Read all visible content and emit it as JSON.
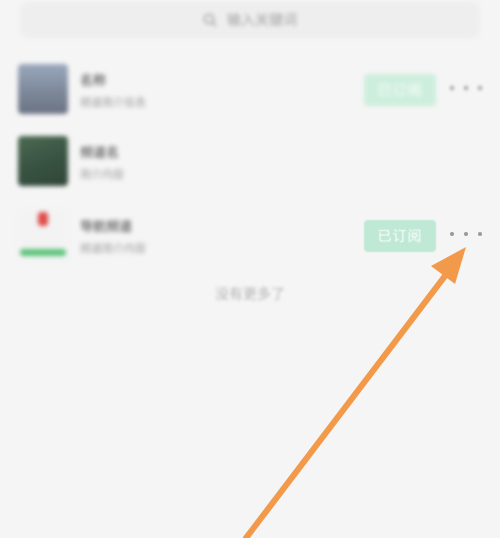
{
  "search": {
    "placeholder": "输入关键词"
  },
  "subscriptions": [
    {
      "title": "名称",
      "subtitle": "频道简介信息",
      "button": "已订阅"
    },
    {
      "title": "频道名",
      "subtitle": "简介内容",
      "button": ""
    },
    {
      "title": "导航频道",
      "subtitle": "频道简介内容",
      "button": "已订阅"
    }
  ],
  "footer": {
    "no_more": "没有更多了"
  },
  "colors": {
    "accent": "#7fd0ad",
    "arrow": "#f2994a"
  },
  "icons": [
    "search-icon",
    "more-dots-icon",
    "arrow-annotation"
  ]
}
